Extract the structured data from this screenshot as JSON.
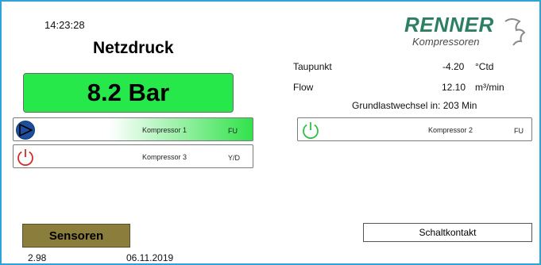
{
  "status": {
    "time": "14:23:28",
    "version": "2.98",
    "date": "06.11.2019"
  },
  "pressure": {
    "title": "Netzdruck",
    "value": "8.2 Bar"
  },
  "brand": {
    "name": "RENNER",
    "sub": "Kompressoren"
  },
  "compressors": [
    {
      "name": "Kompressor 1",
      "type": "FU",
      "state": "running",
      "icon": "play-icon"
    },
    {
      "name": "Kompressor 3",
      "type": "Y/D",
      "state": "off",
      "icon": "power-icon"
    },
    {
      "name": "Kompressor 2",
      "type": "FU",
      "state": "standby",
      "icon": "power-icon"
    }
  ],
  "readings": {
    "dewpoint_label": "Taupunkt",
    "dewpoint_value": "-4.20",
    "dewpoint_unit": "°Ctd",
    "flow_label": "Flow",
    "flow_value": "12.10",
    "flow_unit": "m³/min",
    "baseload_text": "Grundlastwechsel in: 203 Min"
  },
  "buttons": {
    "sensors": "Sensoren",
    "switch_contact": "Schaltkontakt"
  },
  "colors": {
    "pressure_ok": "#27e84a",
    "running": "#31e24b",
    "off": "#d42a2a",
    "standby": "#2fbf47",
    "play": "#1e4f9c",
    "frame": "#2fa3d6",
    "sensor_button": "#8b7d3b",
    "brand": "#2c7f63"
  }
}
